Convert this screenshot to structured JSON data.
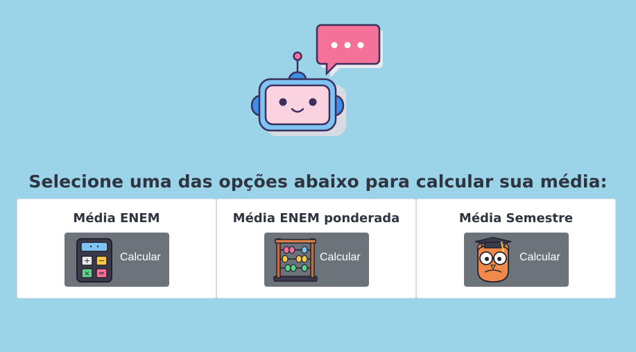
{
  "header": {
    "mascot_icon": "robot-chatbot-icon",
    "speech_icon": "speech-bubble-icon",
    "headline": "Selecione uma das opções abaixo para calcular sua média:"
  },
  "options": [
    {
      "title": "Média ENEM",
      "button_label": "Calcular",
      "icon": "calculator-icon"
    },
    {
      "title": "Média ENEM ponderada",
      "button_label": "Calcular",
      "icon": "abacus-icon"
    },
    {
      "title": "Média Semestre",
      "button_label": "Calcular",
      "icon": "owl-graduate-icon"
    }
  ],
  "colors": {
    "background": "#9bd3e8",
    "card": "#ffffff",
    "button": "#6c737b",
    "bubble": "#f0608a"
  }
}
